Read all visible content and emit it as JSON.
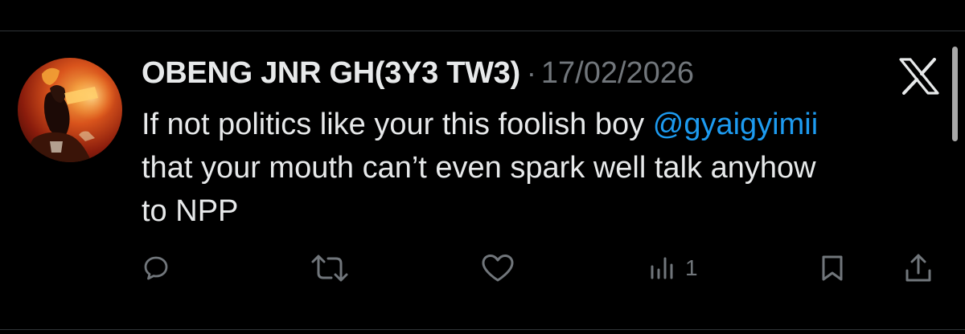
{
  "post": {
    "author_name": "OBENG JNR GH(3Y3 TW3)",
    "separator": "·",
    "date": "17/02/2026",
    "text_line1_before": "If not politics like your this foolish boy ",
    "mention": "@gyaigyimii",
    "text_line2": "that your mouth can’t even spark well talk anyhow",
    "text_line3": "to NPP"
  },
  "avatar": {
    "icon": "avatar-image"
  },
  "brand": {
    "icon": "x-logo-icon"
  },
  "actions": {
    "reply_icon": "reply-icon",
    "repost_icon": "repost-icon",
    "like_icon": "heart-icon",
    "views_icon": "views-chart-icon",
    "views_count": "1",
    "bookmark_icon": "bookmark-icon",
    "share_icon": "share-icon"
  },
  "colors": {
    "background": "#000000",
    "text": "#e7e9ea",
    "muted": "#71767b",
    "mention": "#1d9bf0",
    "divider": "#2f3336"
  }
}
